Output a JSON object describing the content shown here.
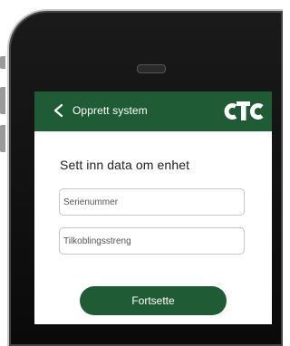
{
  "header": {
    "title": "Opprett system",
    "back_icon": "chevron-left-icon",
    "logo_text": "cTc",
    "color": "#1f5c36"
  },
  "form": {
    "heading": "Sett inn data om enhet",
    "serial_field": {
      "placeholder": "Serienummer",
      "value": ""
    },
    "connection_field": {
      "placeholder": "Tilkoblingsstreng",
      "value": ""
    },
    "continue_label": "Fortsette"
  },
  "colors": {
    "brand_green": "#1f5c36",
    "phone_body": "#111111"
  }
}
